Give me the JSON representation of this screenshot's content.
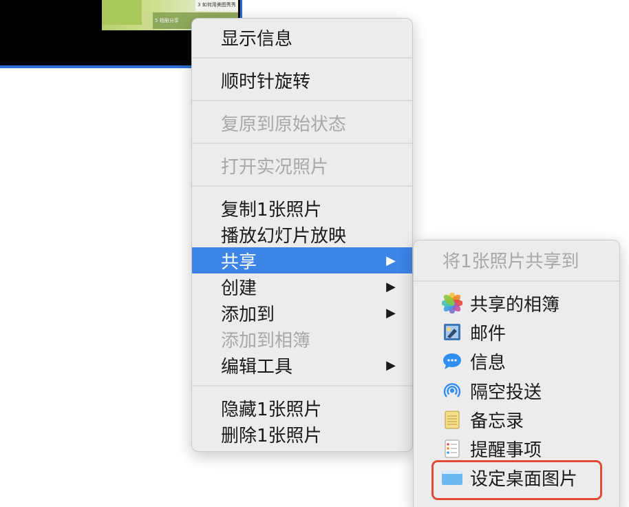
{
  "background_thumbnail": {
    "tile_numbers": [
      "3",
      "5"
    ],
    "tile_captions": [
      "如何用美图秀秀做照片？",
      "相册分享"
    ]
  },
  "context_menu": {
    "items": [
      {
        "label": "显示信息",
        "disabled": false
      },
      {
        "label": "顺时针旋转",
        "disabled": false
      },
      {
        "label": "复原到原始状态",
        "disabled": true
      },
      {
        "label": "打开实况照片",
        "disabled": true
      },
      {
        "label": "复制1张照片",
        "disabled": false
      },
      {
        "label": "播放幻灯片放映",
        "disabled": false
      },
      {
        "label": "共享",
        "disabled": false,
        "highlighted": true,
        "has_submenu": true
      },
      {
        "label": "创建",
        "disabled": false,
        "has_submenu": true
      },
      {
        "label": "添加到",
        "disabled": false,
        "has_submenu": true
      },
      {
        "label": "添加到相簿",
        "disabled": true
      },
      {
        "label": "编辑工具",
        "disabled": false,
        "has_submenu": true
      },
      {
        "label": "隐藏1张照片",
        "disabled": false
      },
      {
        "label": "删除1张照片",
        "disabled": false
      }
    ],
    "submenu_arrow": "▶"
  },
  "share_submenu": {
    "header": "将1张照片共享到",
    "items": [
      {
        "label": "共享的相簿",
        "icon": "photos-icon"
      },
      {
        "label": "邮件",
        "icon": "mail-icon"
      },
      {
        "label": "信息",
        "icon": "messages-icon"
      },
      {
        "label": "隔空投送",
        "icon": "airdrop-icon"
      },
      {
        "label": "备忘录",
        "icon": "notes-icon"
      },
      {
        "label": "提醒事项",
        "icon": "reminders-icon"
      },
      {
        "label": "设定桌面图片",
        "icon": "desktop-picture-icon",
        "annotated": true
      }
    ]
  },
  "colors": {
    "highlight": "#3c84e6",
    "annotation_border": "#e04a33",
    "menu_background": "#ececec"
  }
}
